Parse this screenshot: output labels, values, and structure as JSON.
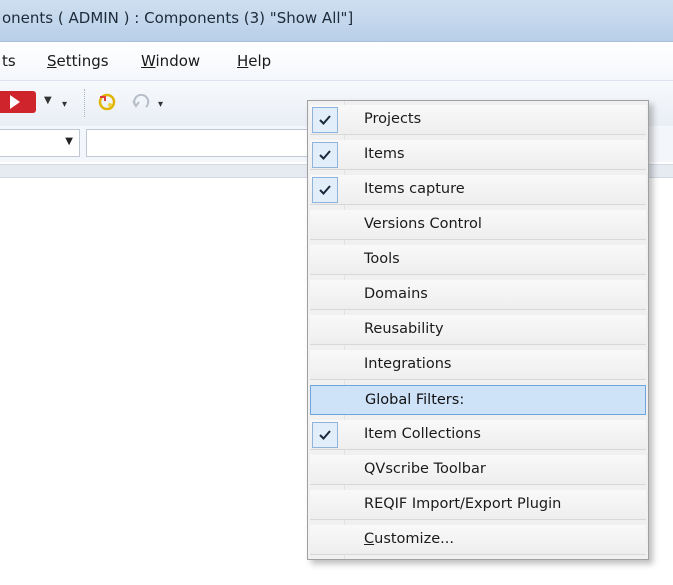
{
  "window": {
    "title": "onents ( ADMIN ) : Components (3) \"Show All\"]"
  },
  "menubar": {
    "items": [
      {
        "pre": "ts",
        "u": "",
        "post": ""
      },
      {
        "pre": "",
        "u": "S",
        "post": "ettings"
      },
      {
        "pre": "",
        "u": "W",
        "post": "indow"
      },
      {
        "pre": "",
        "u": "H",
        "post": "elp"
      }
    ]
  },
  "toolbar": {
    "icons": [
      "run-icon",
      "dropdown-arrow-icon",
      "navigate-icon",
      "undo-icon"
    ]
  },
  "context_menu": {
    "items": [
      {
        "label": "Projects",
        "checked": true,
        "highlighted": false
      },
      {
        "label": "Items",
        "checked": true,
        "highlighted": false
      },
      {
        "label": "Items capture",
        "checked": true,
        "highlighted": false
      },
      {
        "label": "Versions Control",
        "checked": false,
        "highlighted": false
      },
      {
        "label": "Tools",
        "checked": false,
        "highlighted": false
      },
      {
        "label": "Domains",
        "checked": false,
        "highlighted": false
      },
      {
        "label": "Reusability",
        "checked": false,
        "highlighted": false
      },
      {
        "label": "Integrations",
        "checked": false,
        "highlighted": false
      },
      {
        "label": "Global Filters:",
        "checked": false,
        "highlighted": true
      },
      {
        "label": "Item Collections",
        "checked": true,
        "highlighted": false
      },
      {
        "label": "QVscribe Toolbar",
        "checked": false,
        "highlighted": false
      },
      {
        "label": "REQIF Import/Export Plugin",
        "checked": false,
        "highlighted": false
      }
    ],
    "customize": {
      "underlined": "C",
      "rest": "ustomize..."
    }
  }
}
